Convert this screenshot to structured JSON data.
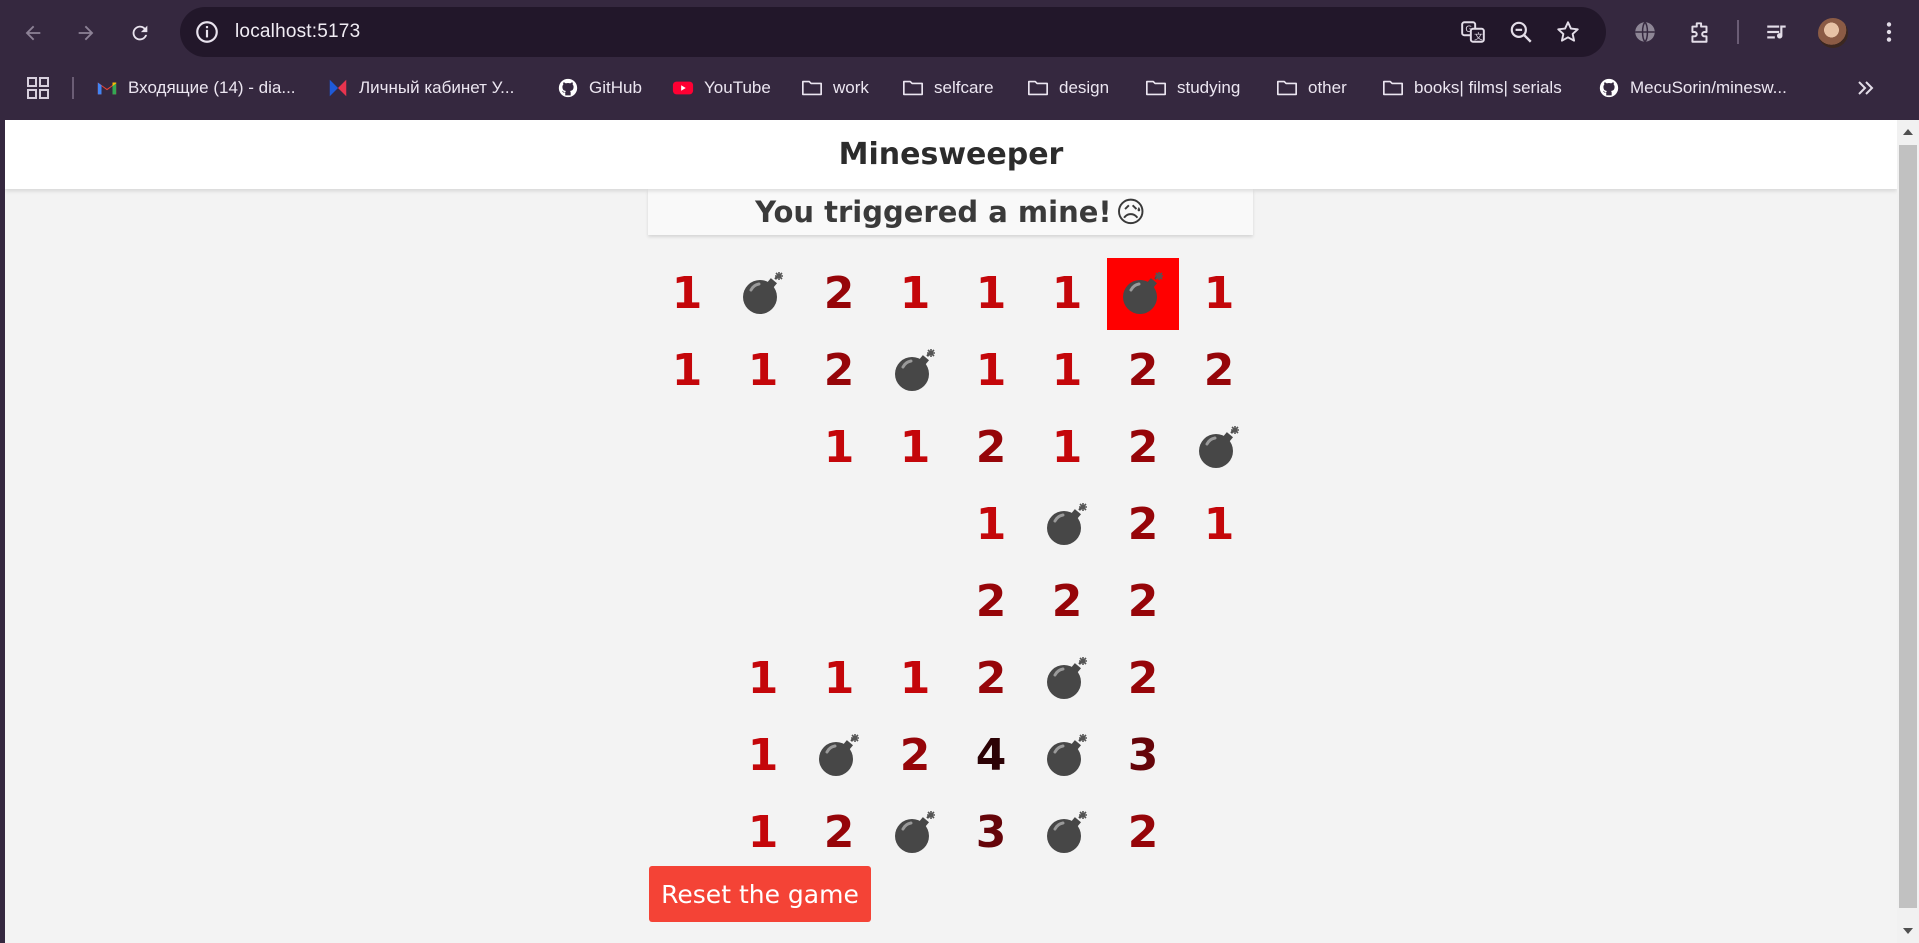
{
  "browser": {
    "url": "localhost:5173",
    "bookmarks": [
      {
        "label": "Входящие (14) - dia...",
        "icon": "gmail-icon"
      },
      {
        "label": "Личный кабинет У...",
        "icon": "bookmark-logo-icon"
      },
      {
        "label": "GitHub",
        "icon": "github-icon"
      },
      {
        "label": "YouTube",
        "icon": "youtube-icon"
      },
      {
        "label": "work",
        "icon": "folder-icon"
      },
      {
        "label": "selfcare",
        "icon": "folder-icon"
      },
      {
        "label": "design",
        "icon": "folder-icon"
      },
      {
        "label": "studying",
        "icon": "folder-icon"
      },
      {
        "label": "other",
        "icon": "folder-icon"
      },
      {
        "label": "books| films| serials",
        "icon": "folder-icon"
      },
      {
        "label": "MecuSorin/minesw...",
        "icon": "github-icon"
      }
    ]
  },
  "page": {
    "title": "Minesweeper",
    "status": "You triggered a mine!",
    "status_emoji": "😥",
    "reset_label": "Reset the game"
  },
  "board": {
    "rows": [
      [
        "1",
        "mine",
        "2",
        "1",
        "1",
        "1",
        "mine-triggered",
        "1"
      ],
      [
        "1",
        "1",
        "2",
        "mine",
        "1",
        "1",
        "2",
        "2"
      ],
      [
        "",
        "",
        "1",
        "1",
        "2",
        "1",
        "2",
        "mine"
      ],
      [
        "",
        "",
        "",
        "",
        "1",
        "mine",
        "2",
        "1"
      ],
      [
        "",
        "",
        "",
        "",
        "2",
        "2",
        "2",
        ""
      ],
      [
        "",
        "1",
        "1",
        "1",
        "2",
        "mine",
        "2",
        ""
      ],
      [
        "",
        "1",
        "mine",
        "2",
        "4",
        "mine",
        "3",
        ""
      ],
      [
        "",
        "1",
        "2",
        "mine",
        "3",
        "mine",
        "2",
        ""
      ]
    ],
    "colors": {
      "1": "#c4060a",
      "2": "#960509",
      "3": "#650409",
      "4": "#2c0205",
      "triggered_bg": "#ff0000"
    }
  }
}
